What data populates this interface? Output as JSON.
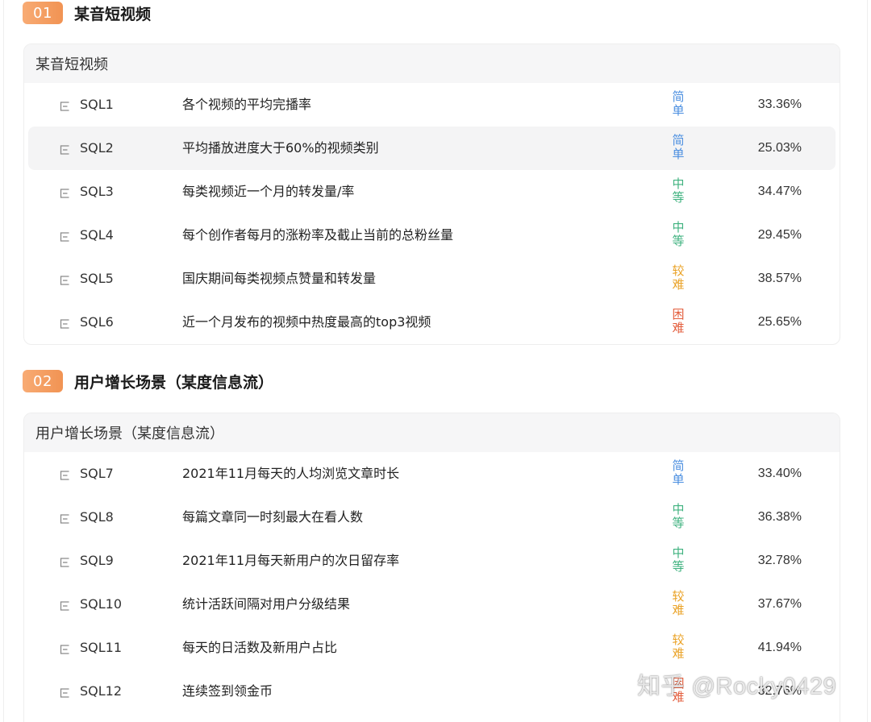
{
  "sections": [
    {
      "number": "01",
      "title": "某音短视频",
      "card_title": "某音短视频",
      "rows": [
        {
          "code": "SQL1",
          "title": "各个视频的平均完播率",
          "difficulty": "简单",
          "level": "easy",
          "rate": "33.36%"
        },
        {
          "code": "SQL2",
          "title": "平均播放进度大于60%的视频类别",
          "difficulty": "简单",
          "level": "easy",
          "rate": "25.03%",
          "highlighted": true
        },
        {
          "code": "SQL3",
          "title": "每类视频近一个月的转发量/率",
          "difficulty": "中等",
          "level": "medium",
          "rate": "34.47%"
        },
        {
          "code": "SQL4",
          "title": "每个创作者每月的涨粉率及截止当前的总粉丝量",
          "difficulty": "中等",
          "level": "medium",
          "rate": "29.45%"
        },
        {
          "code": "SQL5",
          "title": "国庆期间每类视频点赞量和转发量",
          "difficulty": "较难",
          "level": "hard",
          "rate": "38.57%"
        },
        {
          "code": "SQL6",
          "title": "近一个月发布的视频中热度最高的top3视频",
          "difficulty": "困难",
          "level": "expert",
          "rate": "25.65%"
        }
      ]
    },
    {
      "number": "02",
      "title": "用户增长场景（某度信息流）",
      "card_title": "用户增长场景（某度信息流）",
      "rows": [
        {
          "code": "SQL7",
          "title": "2021年11月每天的人均浏览文章时长",
          "difficulty": "简单",
          "level": "easy",
          "rate": "33.40%"
        },
        {
          "code": "SQL8",
          "title": "每篇文章同一时刻最大在看人数",
          "difficulty": "中等",
          "level": "medium",
          "rate": "36.38%"
        },
        {
          "code": "SQL9",
          "title": "2021年11月每天新用户的次日留存率",
          "difficulty": "中等",
          "level": "medium",
          "rate": "32.78%"
        },
        {
          "code": "SQL10",
          "title": "统计活跃间隔对用户分级结果",
          "difficulty": "较难",
          "level": "hard",
          "rate": "37.67%"
        },
        {
          "code": "SQL11",
          "title": "每天的日活数及新用户占比",
          "difficulty": "较难",
          "level": "hard",
          "rate": "41.94%"
        },
        {
          "code": "SQL12",
          "title": "连续签到领金币",
          "difficulty": "困难",
          "level": "expert",
          "rate": "32.76%"
        }
      ]
    }
  ],
  "difficulty_colors": {
    "easy": "#4a8ee0",
    "medium": "#3fb27f",
    "hard": "#eaa226",
    "expert": "#e35d3c"
  },
  "row_icon": "document-icon",
  "watermark": "知乎 @Rocky0429"
}
